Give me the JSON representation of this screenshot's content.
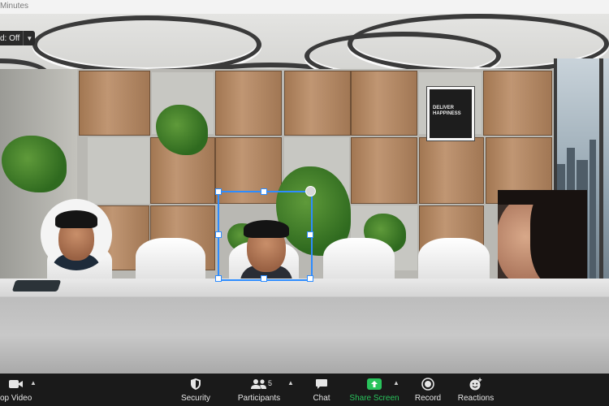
{
  "window": {
    "title": "Minutes"
  },
  "virtual_background_toggle": {
    "label": "d: Off"
  },
  "poster": {
    "text": "DELIVER HAPPINESS"
  },
  "toolbar": {
    "video_label": "op Video",
    "security_label": "Security",
    "participants_label": "Participants",
    "participants_count": "5",
    "chat_label": "Chat",
    "share_label": "Share Screen",
    "record_label": "Record",
    "reactions_label": "Reactions"
  },
  "colors": {
    "share_green": "#29c35c",
    "selection_blue": "#2d8cff",
    "toolbar_bg": "#1a1a1a"
  },
  "icons": [
    "camera-icon",
    "shield-icon",
    "people-icon",
    "chat-bubble-icon",
    "share-arrow-icon",
    "record-icon",
    "emoji-plus-icon",
    "caret-up-icon"
  ]
}
